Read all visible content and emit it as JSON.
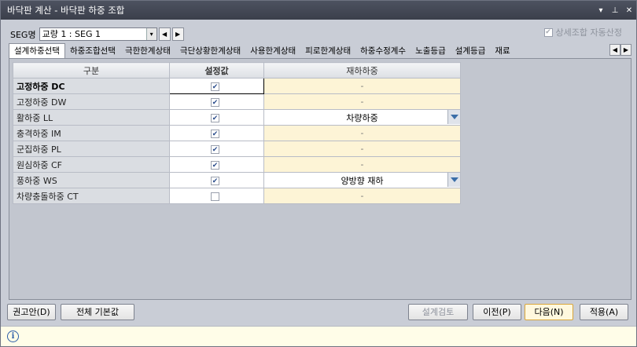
{
  "window": {
    "title": "바닥판 계산 - 바닥판 하중 조합",
    "ctrl_menu": "▾",
    "ctrl_pin": "⊥",
    "ctrl_close": "✕"
  },
  "seg": {
    "label": "SEG명",
    "value": "교량 1 : SEG 1",
    "dropdown_glyph": "▾",
    "prev_glyph": "◀",
    "next_glyph": "▶"
  },
  "auto_check": {
    "label": "상세조합 자동산정",
    "checked": true
  },
  "tabs": [
    {
      "label": "설계하중선택",
      "active": true
    },
    {
      "label": "하중조합선택"
    },
    {
      "label": "극한한계상태"
    },
    {
      "label": "극단상황한계상태"
    },
    {
      "label": "사용한계상태"
    },
    {
      "label": "피로한계상태"
    },
    {
      "label": "하중수정계수"
    },
    {
      "label": "노출등급"
    },
    {
      "label": "설계등급"
    },
    {
      "label": "재료"
    }
  ],
  "tab_scroll": {
    "left": "◀",
    "right": "▶"
  },
  "grid": {
    "headers": [
      "구분",
      "설정값",
      "재하하중"
    ],
    "rows": [
      {
        "name": "고정하중 DC",
        "checked": true,
        "load": "-",
        "bold": true
      },
      {
        "name": "고정하중 DW",
        "checked": true,
        "load": "-"
      },
      {
        "name": "활하중 LL",
        "checked": true,
        "load": "차량하중",
        "combo": true
      },
      {
        "name": "충격하중 IM",
        "checked": true,
        "load": "-"
      },
      {
        "name": "군집하중 PL",
        "checked": true,
        "load": "-"
      },
      {
        "name": "원심하중 CF",
        "checked": true,
        "load": "-"
      },
      {
        "name": "풍하중 WS",
        "checked": true,
        "load": "양방향 재하",
        "combo": true
      },
      {
        "name": "차량충돌하중 CT",
        "checked": false,
        "load": "-"
      }
    ]
  },
  "buttons": {
    "recommend": "권고안(D)",
    "defaults": "전체 기본값",
    "design_check": "설계검토",
    "prev": "이전(P)",
    "next": "다음(N)",
    "apply": "적용(A)"
  },
  "status": {
    "icon": "i"
  }
}
